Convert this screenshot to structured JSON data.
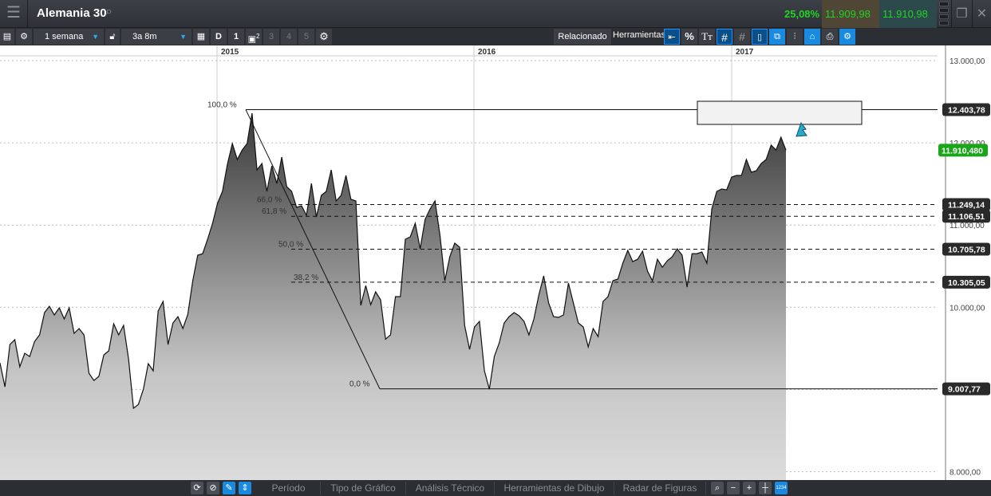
{
  "header": {
    "title": "Alemania 30",
    "change": "25,08%",
    "bid": "11.909,98",
    "ask": "11.910,98"
  },
  "toolbar": {
    "period": "1 semana",
    "range": "3a 8m",
    "d": "D",
    "n1": "1",
    "n2": "2",
    "n3": "3",
    "n4": "4",
    "n5": "5",
    "related": "Relacionado",
    "tools": "Herramientas",
    "pct": "%",
    "text": "Tт"
  },
  "chart": {
    "years": [
      "2015",
      "2016",
      "2017"
    ],
    "y_ticks": [
      {
        "v": 13000,
        "l": "13.000,00"
      },
      {
        "v": 12000,
        "l": "12.000,00"
      },
      {
        "v": 11000,
        "l": "11.000,00"
      },
      {
        "v": 10000,
        "l": "10.000,00"
      },
      {
        "v": 9000,
        "l": "9.000,00"
      },
      {
        "v": 8000,
        "l": "8.000,00"
      }
    ],
    "fib": {
      "high": 12403.78,
      "low": 9007.77,
      "levels": [
        {
          "p": "100,0 %",
          "v": 12403.78,
          "l": "12.403,78"
        },
        {
          "p": "66,0 %",
          "v": 11249.14,
          "l": "11.249,14"
        },
        {
          "p": "61,8 %",
          "v": 11106.51,
          "l": "11.106,51"
        },
        {
          "p": "50,0 %",
          "v": 10705.78,
          "l": "10.705,78"
        },
        {
          "p": "38,2 %",
          "v": 10305.05,
          "l": "10.305,05"
        },
        {
          "p": "0,0 %",
          "v": 9007.77,
          "l": "9.007,77"
        }
      ]
    },
    "last": "11.910,480",
    "colors": {
      "last": "#1aa51a",
      "label": "#2a2a2a"
    }
  },
  "chart_data": {
    "type": "area",
    "ylim": [
      7900,
      13200
    ],
    "yscale": "linear",
    "values": [
      9323,
      9032,
      9547,
      9605,
      9275,
      9440,
      9401,
      9585,
      9663,
      9935,
      10012,
      9906,
      9993,
      9857,
      9993,
      9683,
      9741,
      9663,
      9197,
      9110,
      9159,
      9420,
      9469,
      9799,
      9663,
      9780,
      9372,
      8771,
      8819,
      9003,
      9314,
      9227,
      9954,
      10071,
      9547,
      9809,
      9886,
      9741,
      9915,
      10323,
      10633,
      10652,
      10827,
      11021,
      11264,
      11409,
      11739,
      11991,
      11797,
      11913,
      11991,
      12360,
      11671,
      11749,
      11409,
      11720,
      11506,
      11826,
      11467,
      11409,
      11215,
      11234,
      11118,
      11506,
      11099,
      11361,
      11409,
      11671,
      11293,
      11361,
      11603,
      11312,
      11293,
      10022,
      10264,
      10031,
      10187,
      10090,
      9612,
      9663,
      10129,
      10129,
      10827,
      10856,
      11021,
      10711,
      11070,
      11196,
      11293,
      10876,
      10323,
      10614,
      10780,
      10730,
      9780,
      9488,
      9760,
      9828,
      9227,
      9003,
      9401,
      9566,
      9809,
      9886,
      9935,
      9896,
      9828,
      9663,
      9857,
      10148,
      10381,
      10051,
      9886,
      9877,
      9906,
      10294,
      10051,
      9809,
      9760,
      9518,
      9741,
      9643,
      10071,
      10129,
      10323,
      10342,
      10536,
      10692,
      10555,
      10584,
      10682,
      10439,
      10323,
      10584,
      10487,
      10565,
      10614,
      10711,
      10633,
      10245,
      10652,
      10652,
      10672,
      10536,
      11196,
      11409,
      11438,
      11428,
      11583,
      11603,
      11603,
      11797,
      11642,
      11661,
      11749,
      11797,
      11972,
      11913,
      12068,
      11910
    ]
  },
  "bottom": {
    "tabs": [
      "Período",
      "Tipo de Gráfico",
      "Análisis Técnico",
      "Herramientas de Dibujo",
      "Radar de Figuras"
    ],
    "num": "1234"
  }
}
